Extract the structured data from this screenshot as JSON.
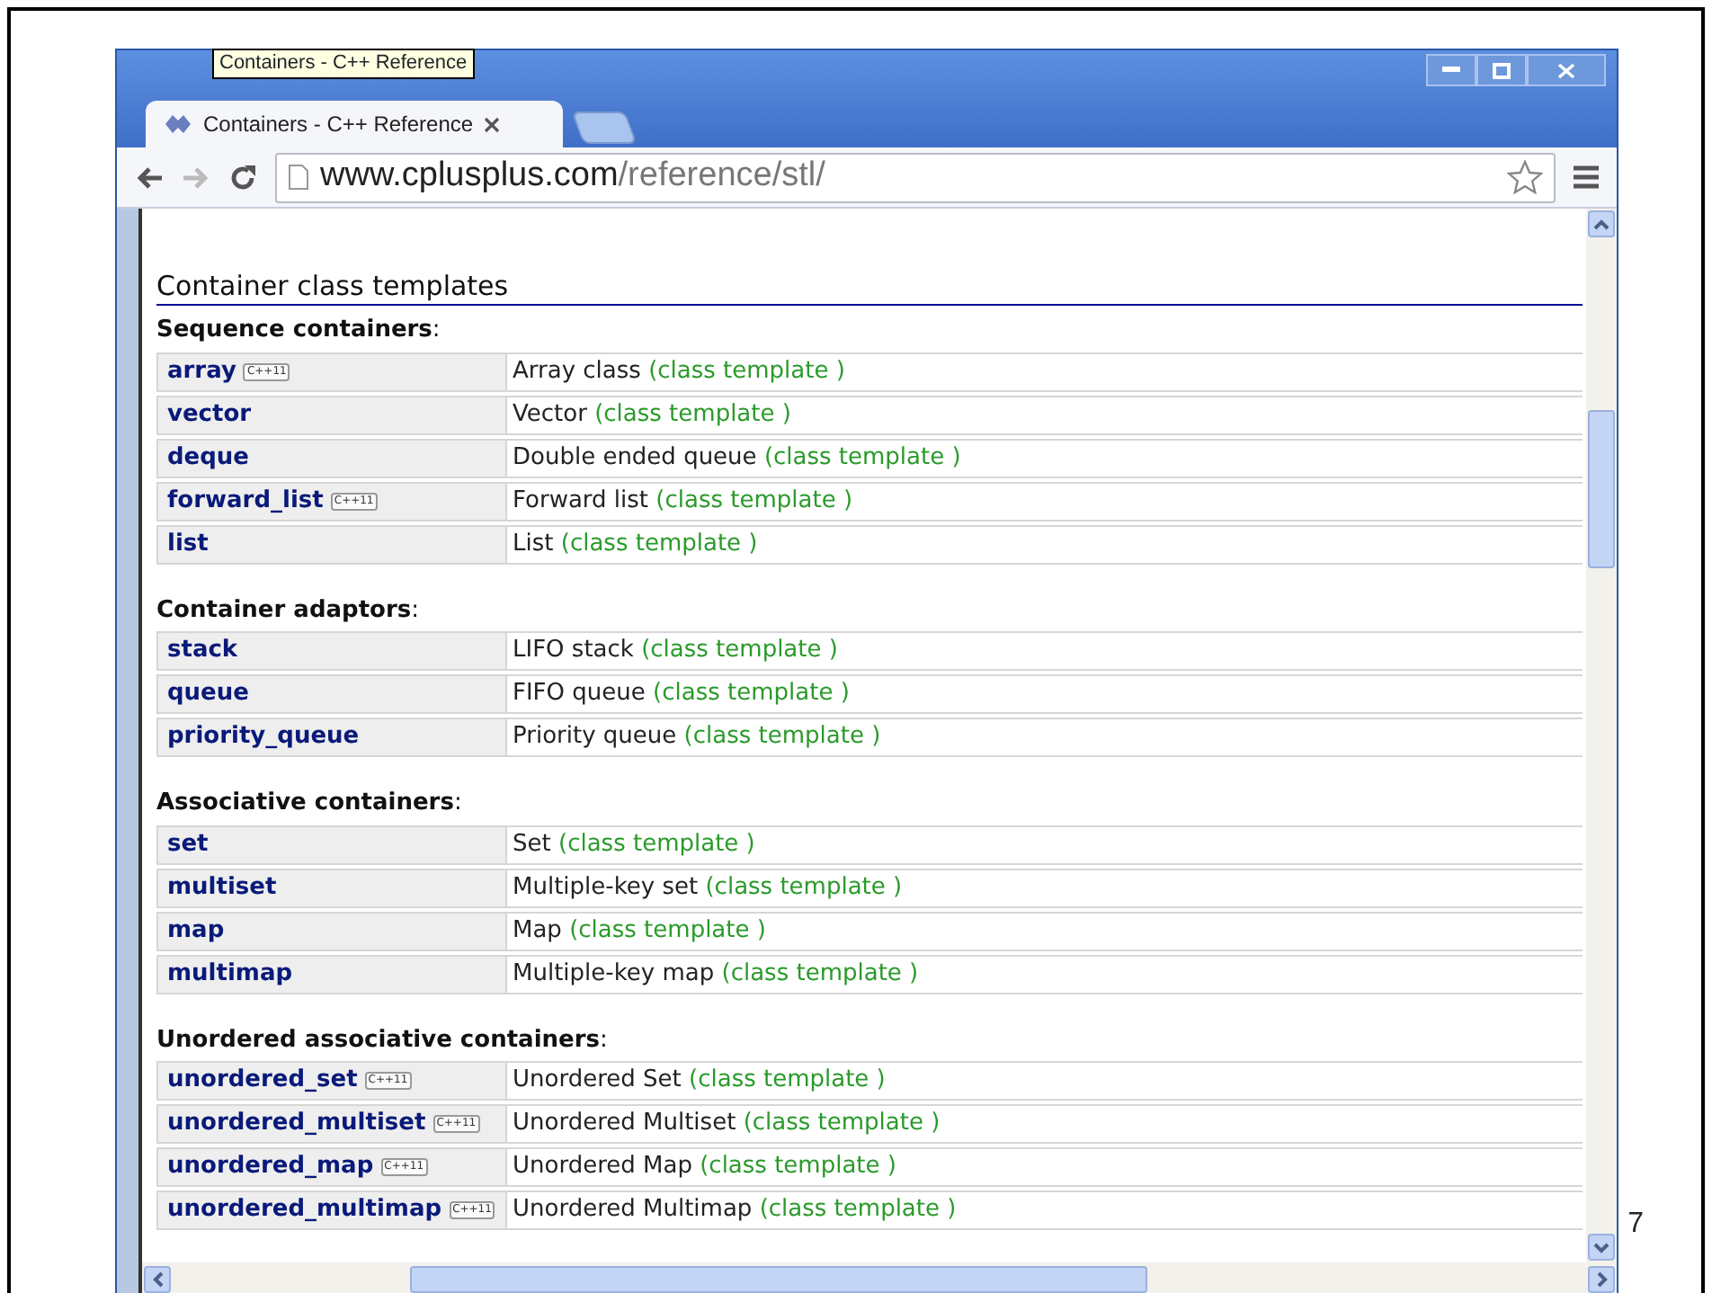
{
  "tooltip": "Containers - C++ Reference",
  "tabs": [
    {
      "title": "Containers - C++ Reference",
      "selected": true
    }
  ],
  "nav": {
    "back_disabled": false,
    "forward_disabled": true
  },
  "address": {
    "host": "www.cplusplus.com",
    "path": "/reference/stl/"
  },
  "page": {
    "heading": "Container class templates",
    "sections": [
      {
        "title": "**Sequence containers**:",
        "rows": [
          {
            "name": "array",
            "badge": "C++11",
            "description": "Array class",
            "type": "(class template )"
          },
          {
            "name": "vector",
            "description": "Vector",
            "type": "(class template )"
          },
          {
            "name": "deque",
            "description": "Double ended queue",
            "type": "(class template )"
          },
          {
            "name": "forward_list",
            "badge": "C++11",
            "description": "Forward list",
            "type": "(class template )"
          },
          {
            "name": "list",
            "description": "List",
            "type": "(class template )"
          }
        ]
      },
      {
        "title": "**Container adaptors**:",
        "rows": [
          {
            "name": "stack",
            "description": "LIFO stack",
            "type": "(class template )"
          },
          {
            "name": "queue",
            "description": "FIFO queue",
            "type": "(class template )"
          },
          {
            "name": "priority_queue",
            "description": "Priority queue",
            "type": "(class template )"
          }
        ]
      },
      {
        "title": "**Associative containers**:",
        "rows": [
          {
            "name": "set",
            "description": "Set",
            "type": "(class template )"
          },
          {
            "name": "multiset",
            "description": "Multiple-key set",
            "type": "(class template )"
          },
          {
            "name": "map",
            "description": "Map",
            "type": "(class template )"
          },
          {
            "name": "multimap",
            "description": "Multiple-key map",
            "type": "(class template )"
          }
        ]
      },
      {
        "title": "**Unordered associative containers**:",
        "rows": [
          {
            "name": "unordered_set",
            "badge": "C++11",
            "description": "Unordered Set",
            "type": "(class template )"
          },
          {
            "name": "unordered_multiset",
            "badge": "C++11",
            "description": "Unordered Multiset",
            "type": "(class template )"
          },
          {
            "name": "unordered_map",
            "badge": "C++11",
            "description": "Unordered Map",
            "type": "(class template )"
          },
          {
            "name": "unordered_multimap",
            "badge": "C++11",
            "description": "Unordered Multimap",
            "type": "(class template )"
          }
        ]
      }
    ]
  },
  "slide_number": "7"
}
